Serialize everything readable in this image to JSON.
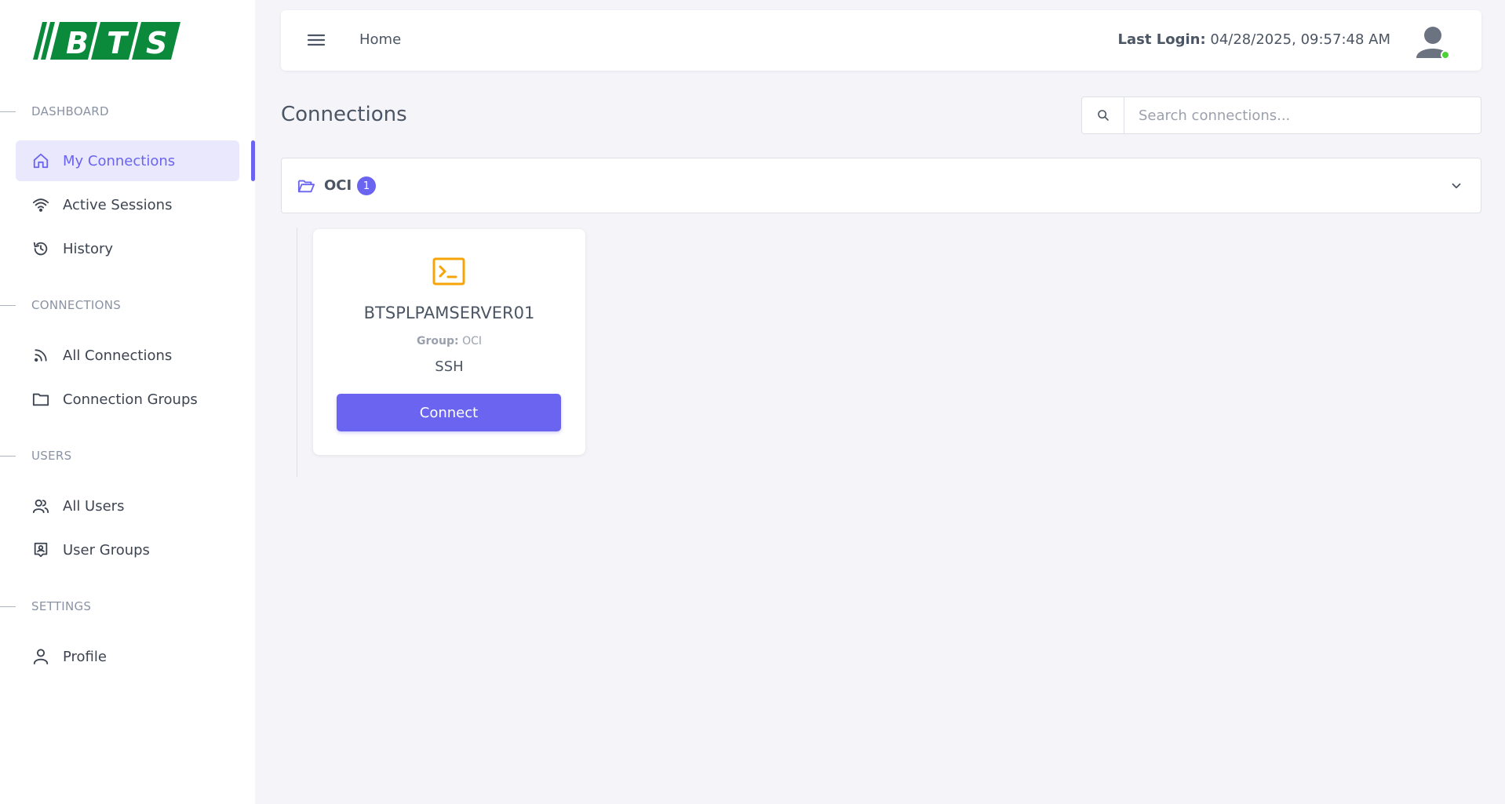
{
  "brand": {
    "logo_text": "BTS",
    "logo_color": "#0b8a3c"
  },
  "sidebar": {
    "sections": [
      {
        "label": "DASHBOARD"
      },
      {
        "label": "CONNECTIONS"
      },
      {
        "label": "USERS"
      },
      {
        "label": "SETTINGS"
      }
    ],
    "items": [
      {
        "label": "My Connections",
        "icon": "home-icon",
        "active": true
      },
      {
        "label": "Active Sessions",
        "icon": "wifi-icon"
      },
      {
        "label": "History",
        "icon": "history-icon"
      },
      {
        "label": "All Connections",
        "icon": "rss-icon"
      },
      {
        "label": "Connection Groups",
        "icon": "folder-icon"
      },
      {
        "label": "All Users",
        "icon": "users-icon"
      },
      {
        "label": "User Groups",
        "icon": "user-group-icon"
      },
      {
        "label": "Profile",
        "icon": "user-icon"
      }
    ]
  },
  "header": {
    "breadcrumb": "Home",
    "last_login_label": "Last Login:",
    "last_login_value": "04/28/2025, 09:57:48 AM"
  },
  "main": {
    "title": "Connections",
    "search": {
      "placeholder": "Search connections..."
    },
    "group": {
      "name": "OCI",
      "count": "1"
    },
    "connection": {
      "name": "BTSPLPAMSERVER01",
      "group_label": "Group:",
      "group_value": "OCI",
      "protocol": "SSH",
      "button_label": "Connect"
    }
  },
  "colors": {
    "accent": "#6a64f1",
    "terminal": "#f5a40a",
    "online": "#4cd137"
  }
}
